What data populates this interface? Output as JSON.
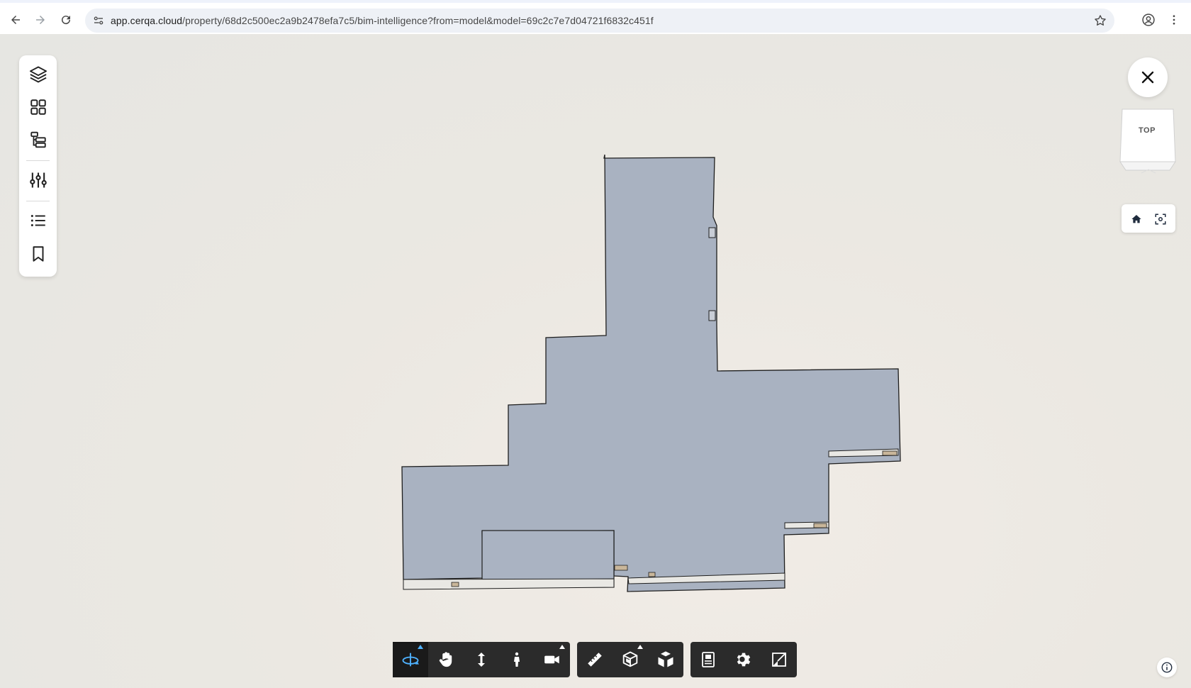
{
  "browser": {
    "url_host": "app.cerqa.cloud",
    "url_path": "/property/68d2c500ec2a9b2478efa7c5/bim-intelligence?from=model&model=69c2c7e7d04721f6832c451f",
    "icons": [
      "back-icon",
      "forward-icon",
      "reload-icon",
      "site-settings-icon",
      "bookmark-star-icon",
      "profile-icon",
      "more-menu-icon"
    ]
  },
  "left_toolbar": {
    "items": [
      {
        "name": "layers",
        "icon": "layers-icon"
      },
      {
        "name": "grid",
        "icon": "grid-icon"
      },
      {
        "name": "model-tree",
        "icon": "tree-hierarchy-icon"
      },
      {
        "name": "filters",
        "icon": "sliders-icon"
      },
      {
        "name": "list",
        "icon": "list-icon"
      },
      {
        "name": "bookmarks",
        "icon": "bookmark-icon"
      }
    ]
  },
  "view_cube": {
    "face": "TOP"
  },
  "bottom_toolbar": {
    "accent": "#4fb2ff",
    "groups": [
      [
        "orbit",
        "pan",
        "zoom",
        "first-person",
        "camera"
      ],
      [
        "measure",
        "section",
        "explode"
      ],
      [
        "model-properties",
        "settings",
        "fullscreen"
      ]
    ]
  },
  "colors": {
    "model_fill": "#a9b2c1",
    "model_stroke": "#1e1e1e",
    "toolbar_bg": "#2b2b2b"
  }
}
